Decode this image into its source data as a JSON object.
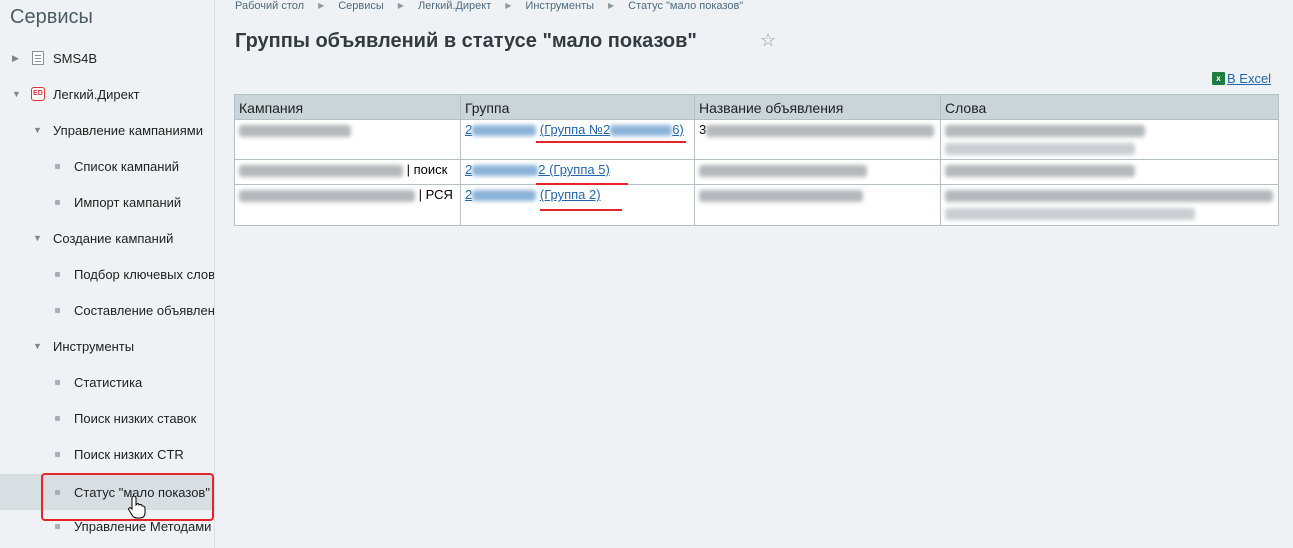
{
  "sidebar": {
    "title": "Сервисы",
    "items": [
      {
        "label": "SMS4B"
      },
      {
        "label": "Легкий.Директ",
        "icon_text": "ED"
      },
      {
        "label": "Управление кампаниями"
      },
      {
        "label": "Список кампаний"
      },
      {
        "label": "Импорт кампаний"
      },
      {
        "label": "Создание кампаний"
      },
      {
        "label": "Подбор ключевых слов"
      },
      {
        "label": "Составление объявлени"
      },
      {
        "label": "Инструменты"
      },
      {
        "label": "Статистика"
      },
      {
        "label": "Поиск низких ставок"
      },
      {
        "label": "Поиск низких CTR"
      },
      {
        "label": "Статус \"мало показов\""
      },
      {
        "label": "Управление Методами"
      }
    ]
  },
  "breadcrumb": [
    "Рабочий стол",
    "Сервисы",
    "Легкий.Директ",
    "Инструменты",
    "Статус \"мало показов\""
  ],
  "page": {
    "title": "Группы объявлений в статусе \"мало показов\"",
    "excel_label": "В Excel",
    "excel_icon": "x"
  },
  "table": {
    "headers": [
      "Кампания",
      "Группа",
      "Название объявления",
      "Слова"
    ],
    "rows": [
      {
        "campaign_suffix": "",
        "group_prefix": "2",
        "group_link": "(Группа №2",
        "group_link_end": "6)",
        "ad_prefix": "3"
      },
      {
        "campaign_suffix": "| поиск",
        "group_prefix": "2",
        "group_link": "2 (Группа 5)",
        "group_link_end": "",
        "ad_prefix": ""
      },
      {
        "campaign_suffix": "| РСЯ",
        "group_prefix": "2",
        "group_link": "(Группа 2)",
        "group_link_end": "",
        "ad_prefix": ""
      }
    ]
  },
  "colors": {
    "accent": "#e4262b",
    "link": "#2067b0",
    "header_bg": "#cad5da"
  }
}
